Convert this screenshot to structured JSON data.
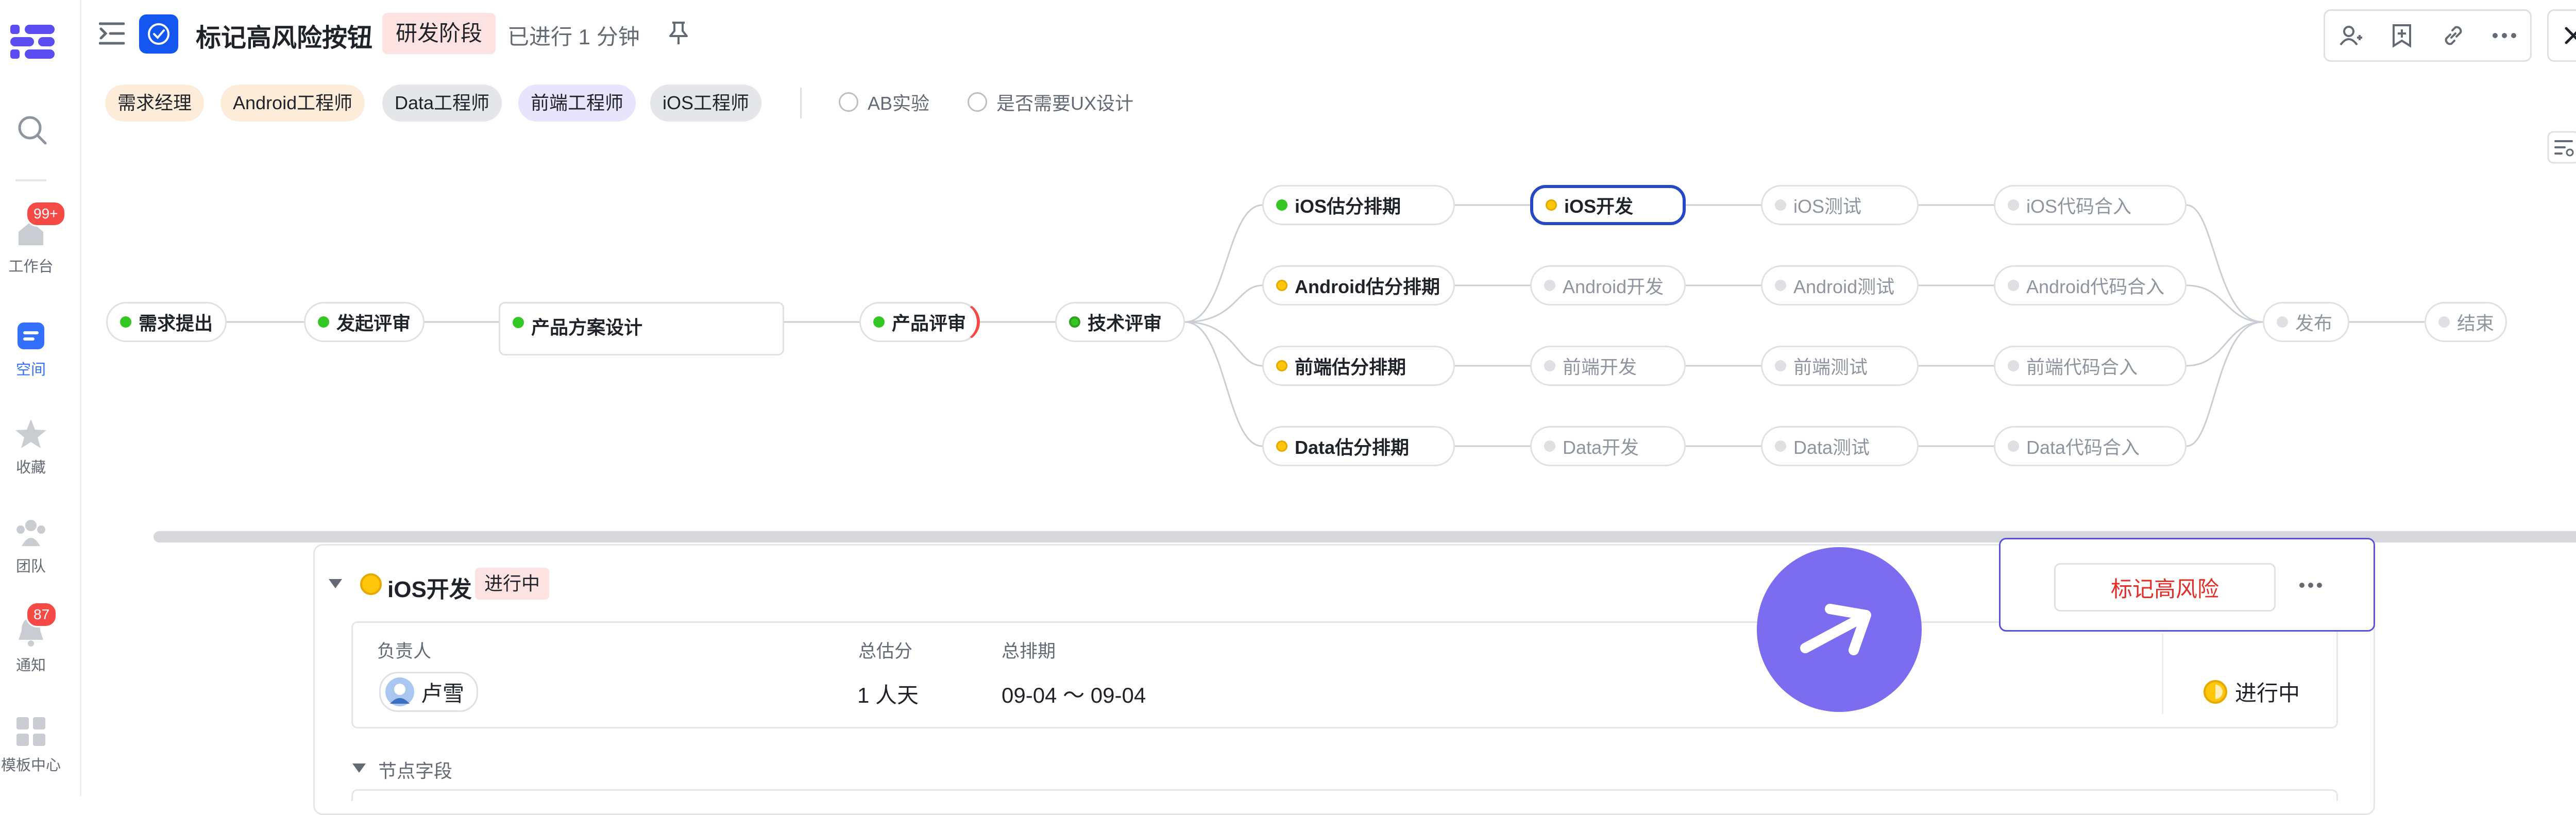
{
  "sidebar": {
    "items": [
      {
        "label": "工作台",
        "badge": "99+"
      },
      {
        "label": "空间"
      },
      {
        "label": "收藏"
      },
      {
        "label": "团队"
      },
      {
        "label": "通知",
        "badge": "87"
      },
      {
        "label": "模板中心"
      }
    ]
  },
  "header": {
    "title": "标记高风险按钮",
    "stage": "研发阶段",
    "elapsed": "已进行 1 分钟"
  },
  "roles": [
    "需求经理",
    "Android工程师",
    "Data工程师",
    "前端工程师",
    "iOS工程师"
  ],
  "options": [
    "AB实验",
    "是否需要UX设计"
  ],
  "flow": {
    "main": [
      "需求提出",
      "发起评审",
      "产品方案设计",
      "产品评审",
      "技术评审"
    ],
    "rows": [
      [
        "iOS估分排期",
        "iOS开发",
        "iOS测试",
        "iOS代码合入"
      ],
      [
        "Android估分排期",
        "Android开发",
        "Android测试",
        "Android代码合入"
      ],
      [
        "前端估分排期",
        "前端开发",
        "前端测试",
        "前端代码合入"
      ],
      [
        "Data估分排期",
        "Data开发",
        "Data测试",
        "Data代码合入"
      ]
    ],
    "end": [
      "发布",
      "结束"
    ]
  },
  "detail": {
    "title": "iOS开发",
    "status": "进行中",
    "owner_label": "负责人",
    "owner": "卢雪",
    "estimate_label": "总估分",
    "estimate": "1 人天",
    "schedule_label": "总排期",
    "schedule": "09-04 ～ 09-04",
    "state": "进行中",
    "section": "节点字段"
  },
  "popup": {
    "mark_label": "标记高风险"
  },
  "colors": {
    "accent": "#3370ff",
    "danger": "#e22e28",
    "fab": "#7b6cf0",
    "active_border": "#2448c6"
  }
}
